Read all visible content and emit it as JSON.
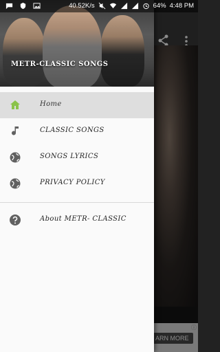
{
  "status_bar": {
    "net_speed": "40.52K/s",
    "battery": "64%",
    "time": "4:48 PM"
  },
  "drawer": {
    "header_title": "METR-CLASSIC SONGS",
    "items": [
      {
        "label": "Home",
        "icon": "home-icon"
      },
      {
        "label": "CLASSIC SONGS",
        "icon": "music-note-icon"
      },
      {
        "label": "SONGS LYRICS",
        "icon": "globe-icon"
      },
      {
        "label": "PRIVACY POLICY",
        "icon": "globe-icon"
      }
    ],
    "secondary_items": [
      {
        "label": "About METR- CLASSIC",
        "icon": "help-icon"
      }
    ]
  },
  "ad": {
    "cta_label": "ARN MORE"
  },
  "colors": {
    "accent": "#8bc34a",
    "icon_gray": "#616161"
  }
}
